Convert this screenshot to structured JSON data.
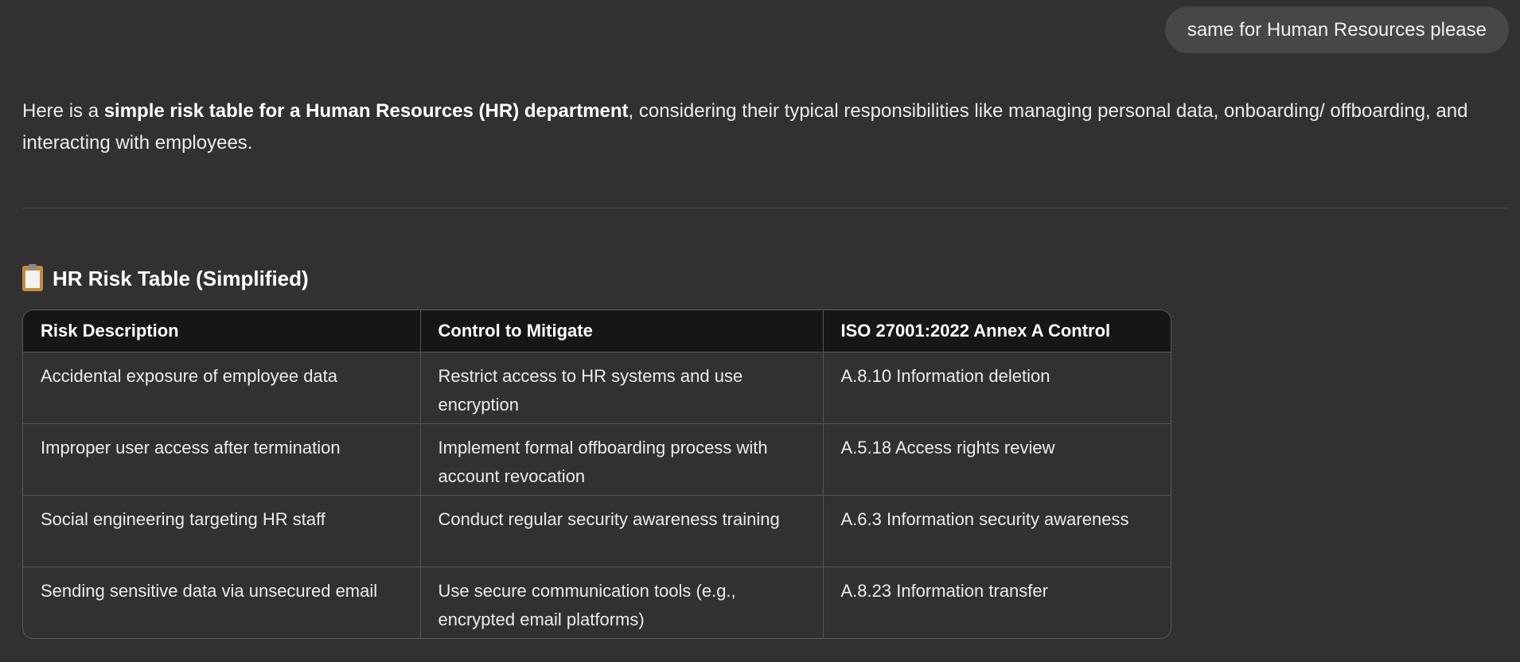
{
  "user_message": "same for Human Resources please",
  "intro": {
    "prefix": "Here is a ",
    "bold": "simple risk table for a Human Resources (HR) department",
    "suffix": ", considering their typical responsibilities like managing personal data, onboarding/ offboarding, and interacting with employees."
  },
  "heading": {
    "icon": "clipboard-icon",
    "title": "HR Risk Table (Simplified)"
  },
  "table": {
    "headers": [
      "Risk Description",
      "Control to Mitigate",
      "ISO 27001:2022 Annex A Control"
    ],
    "rows": [
      [
        "Accidental exposure of employee data",
        "Restrict access to HR systems and use encryption",
        "A.8.10 Information deletion"
      ],
      [
        "Improper user access after termination",
        "Implement formal offboarding process with account revocation",
        "A.5.18 Access rights review"
      ],
      [
        "Social engineering targeting HR staff",
        "Conduct regular security awareness training",
        "A.6.3 Information security awareness"
      ],
      [
        "Sending sensitive data via unsecured email",
        "Use secure communication tools (e.g., encrypted email platforms)",
        "A.8.23 Information transfer"
      ]
    ]
  },
  "colors": {
    "background": "#313131",
    "user_bubble": "#474747",
    "table_header": "#161616",
    "border": "#555555"
  }
}
